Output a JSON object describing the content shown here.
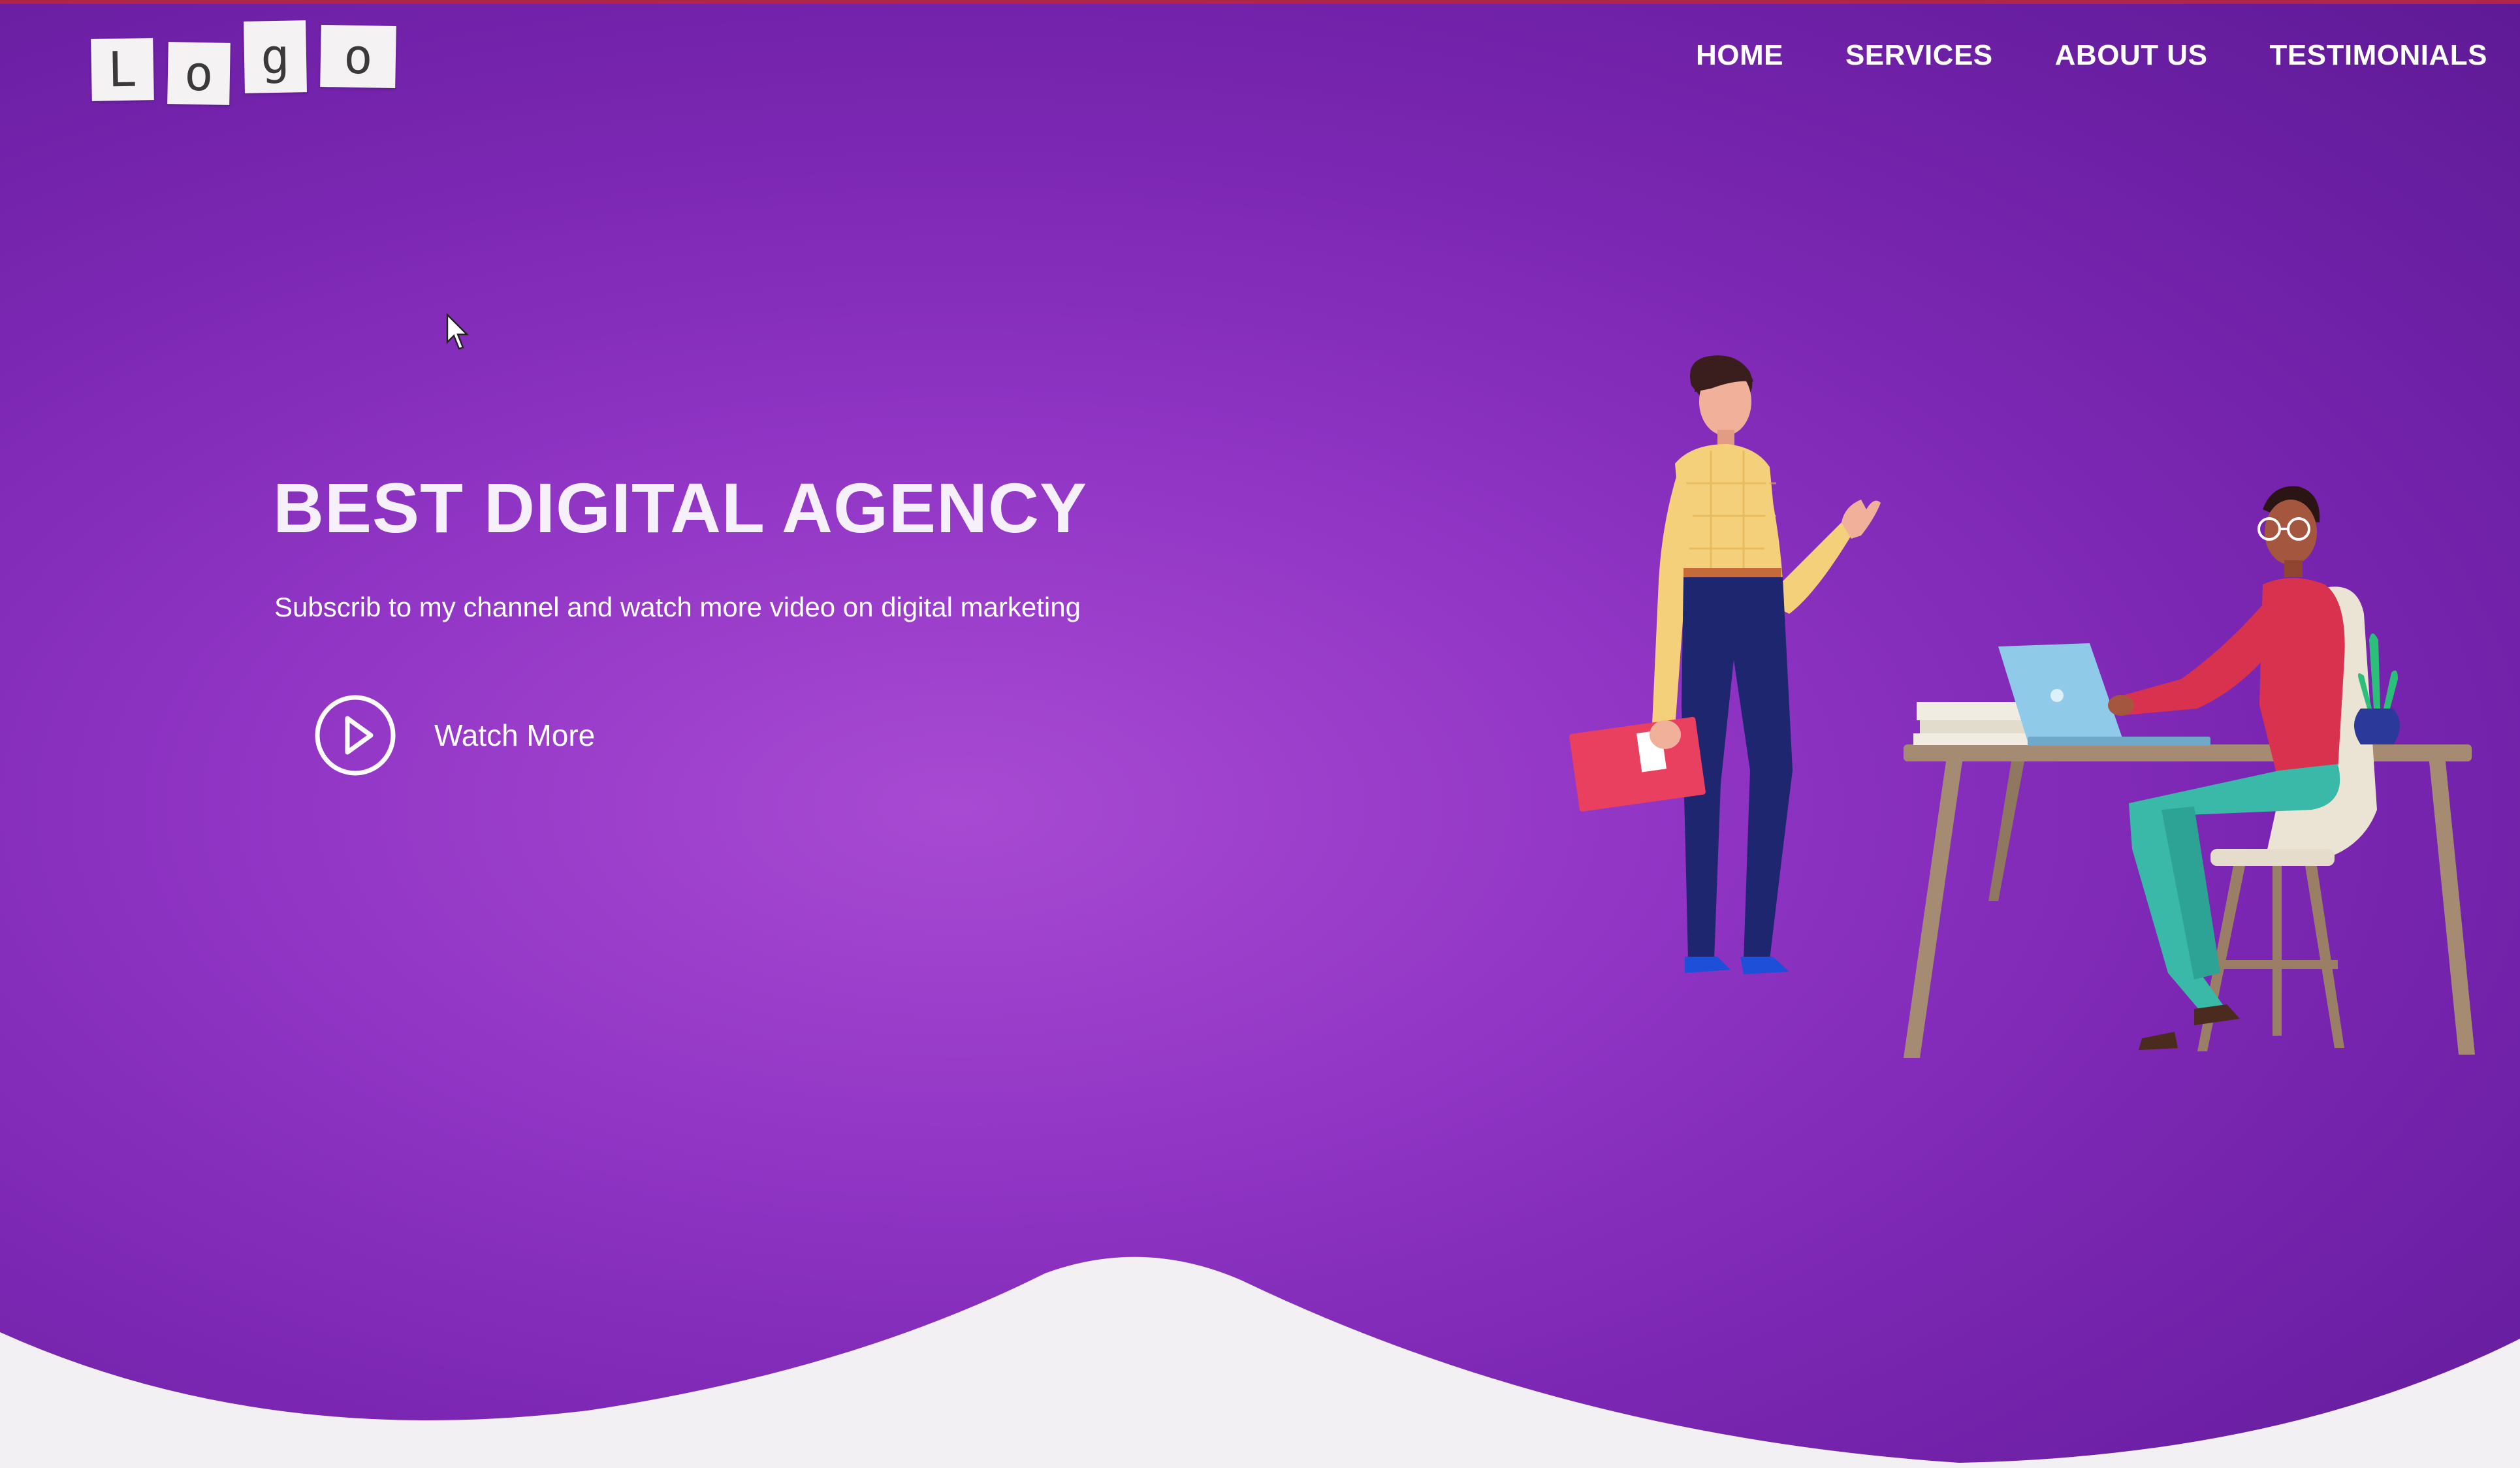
{
  "logo": {
    "letters": [
      "L",
      "o",
      "g",
      "o"
    ]
  },
  "nav": {
    "items": [
      {
        "label": "HOME"
      },
      {
        "label": "SERVICES"
      },
      {
        "label": "ABOUT US"
      },
      {
        "label": "TESTIMONIALS"
      }
    ]
  },
  "hero": {
    "title": "BEST DIGITAL AGENCY",
    "subtitle": "Subscrib to my channel and watch more video on digital marketing",
    "cta_label": "Watch More",
    "cta_icon": "play-circle-icon"
  },
  "colors": {
    "background_center": "#a84ad2",
    "background_edge": "#5e1a96",
    "wave": "#f2f0f2",
    "text": "#ffffff"
  }
}
